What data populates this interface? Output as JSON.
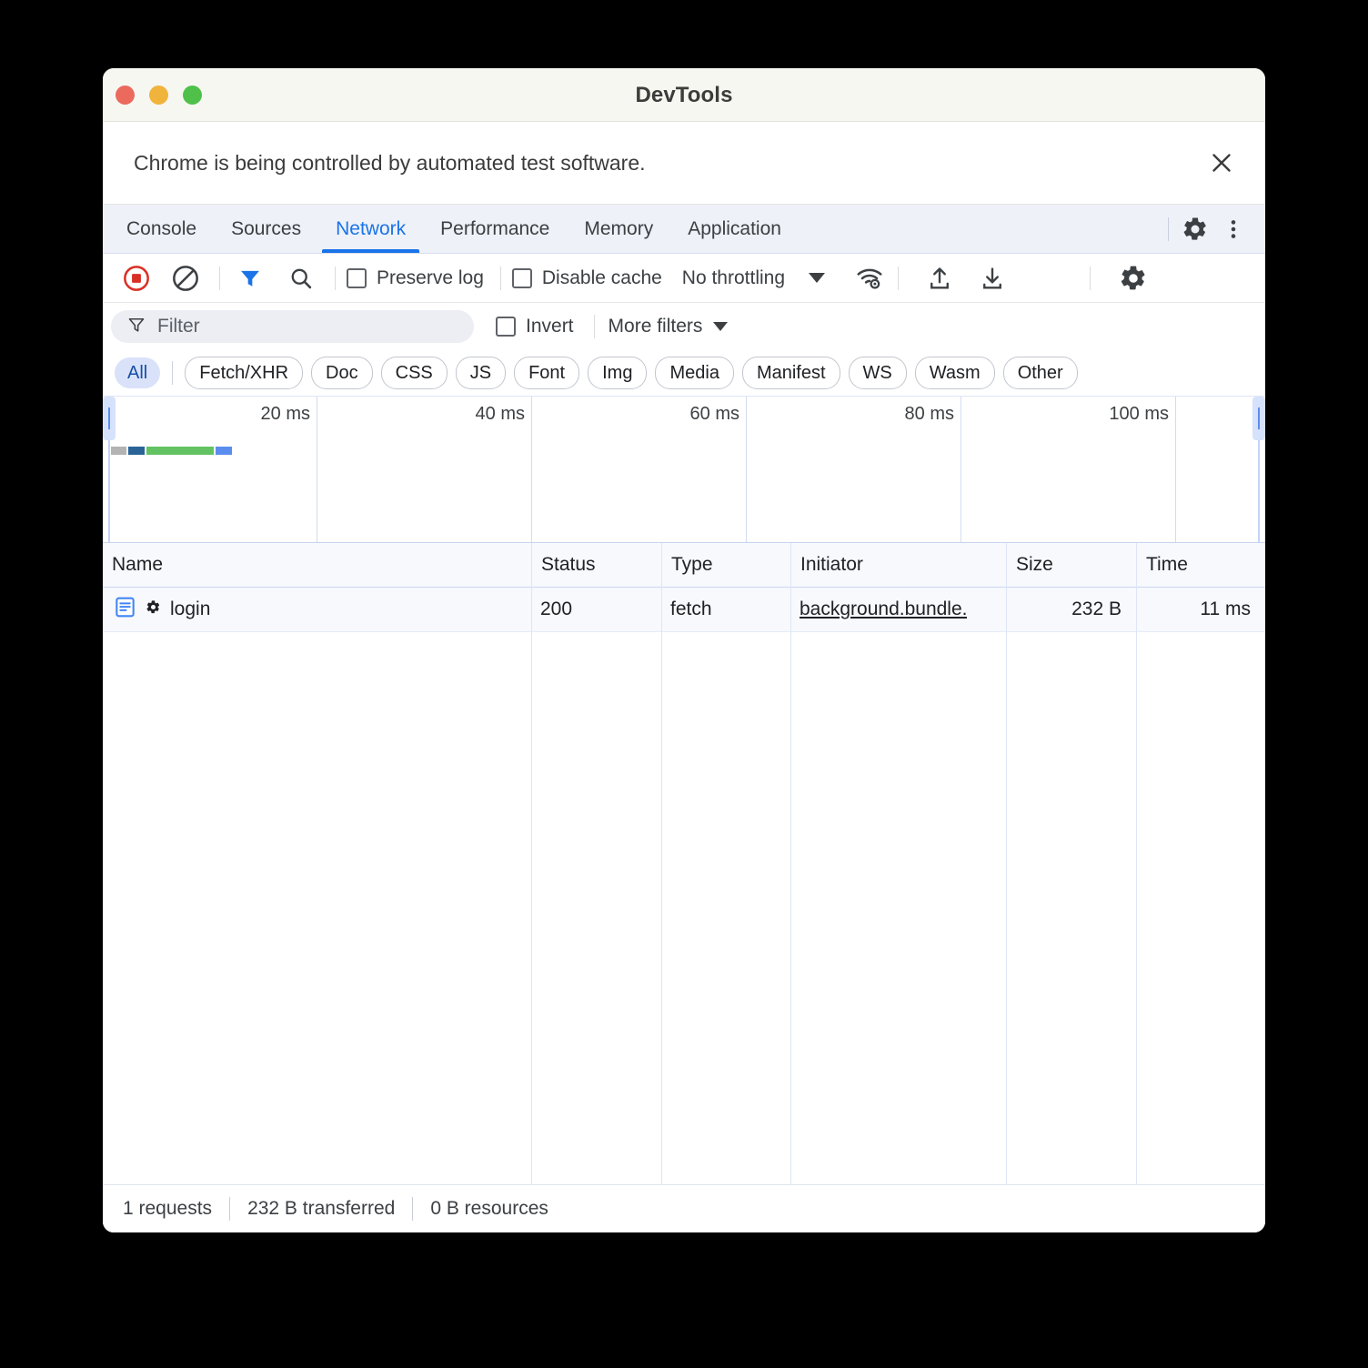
{
  "window": {
    "title": "DevTools",
    "traffic_lights": [
      "close",
      "minimize",
      "zoom"
    ]
  },
  "banner": {
    "message": "Chrome is being controlled by automated test software.",
    "close_icon": "close-icon"
  },
  "panel_tabs": {
    "items": [
      {
        "label": "Console",
        "active": false
      },
      {
        "label": "Sources",
        "active": false
      },
      {
        "label": "Network",
        "active": true
      },
      {
        "label": "Performance",
        "active": false
      },
      {
        "label": "Memory",
        "active": false
      },
      {
        "label": "Application",
        "active": false
      }
    ],
    "settings_icon": "gear-icon",
    "more_icon": "kebab-menu-icon"
  },
  "network_toolbar": {
    "record_icon": "record-stop-icon",
    "clear_icon": "clear-icon",
    "filter_icon": "filter-icon",
    "search_icon": "search-icon",
    "preserve_log": {
      "label": "Preserve log",
      "checked": false
    },
    "disable_cache": {
      "label": "Disable cache",
      "checked": false
    },
    "throttling": {
      "value": "No throttling",
      "caret": "chevron-down-icon"
    },
    "network_conditions_icon": "wifi-settings-icon",
    "import_icon": "upload-icon",
    "export_icon": "download-icon",
    "settings_icon": "gear-icon"
  },
  "filter_bar": {
    "filter_input": {
      "placeholder": "Filter",
      "value": "",
      "icon": "filter-icon"
    },
    "invert": {
      "label": "Invert",
      "checked": false
    },
    "more_filters": {
      "label": "More filters",
      "caret": "chevron-down-icon"
    }
  },
  "type_chips": [
    {
      "label": "All",
      "active": true
    },
    {
      "label": "Fetch/XHR",
      "active": false
    },
    {
      "label": "Doc",
      "active": false
    },
    {
      "label": "CSS",
      "active": false
    },
    {
      "label": "JS",
      "active": false
    },
    {
      "label": "Font",
      "active": false
    },
    {
      "label": "Img",
      "active": false
    },
    {
      "label": "Media",
      "active": false
    },
    {
      "label": "Manifest",
      "active": false
    },
    {
      "label": "WS",
      "active": false
    },
    {
      "label": "Wasm",
      "active": false
    },
    {
      "label": "Other",
      "active": false
    }
  ],
  "overview": {
    "ticks": [
      "20 ms",
      "40 ms",
      "60 ms",
      "80 ms",
      "100 ms"
    ],
    "waterfall_segments": [
      {
        "name": "queueing",
        "color": "#b3b3b3",
        "width": 17
      },
      {
        "name": "stalled",
        "color": "#2a6496",
        "width": 18
      },
      {
        "name": "waiting",
        "color": "#63c363",
        "width": 74
      },
      {
        "name": "download",
        "color": "#5b8def",
        "width": 18
      }
    ]
  },
  "requests_table": {
    "columns": [
      "Name",
      "Status",
      "Type",
      "Initiator",
      "Size",
      "Time"
    ],
    "rows": [
      {
        "name": "login",
        "name_icon": "document-icon",
        "name_badge_icon": "gear-icon",
        "status": "200",
        "type": "fetch",
        "initiator": "background.bundle.",
        "size": "232 B",
        "time": "11 ms"
      }
    ]
  },
  "status_bar": {
    "requests": "1 requests",
    "transferred": "232 B transferred",
    "resources": "0 B resources"
  },
  "colors": {
    "accent": "#1a73e8",
    "chip_active_bg": "#d9e2f8",
    "record_red": "#d93025"
  }
}
